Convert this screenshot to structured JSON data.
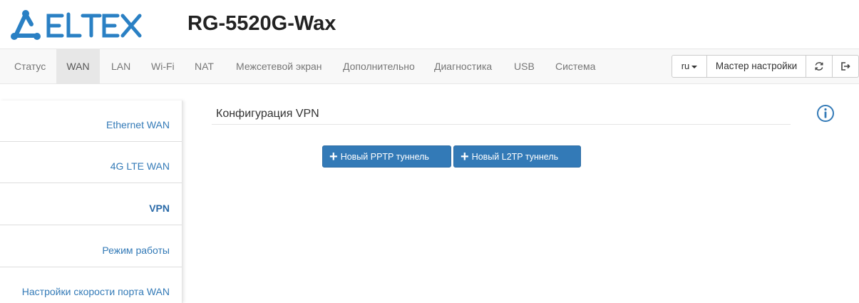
{
  "brand": {
    "logo_text": "ELTEX",
    "model": "RG-5520G-Wax",
    "logo_color": "#2a80c4"
  },
  "navbar": {
    "items": [
      {
        "label": "Статус"
      },
      {
        "label": "WAN",
        "active": true
      },
      {
        "label": "LAN"
      },
      {
        "label": "Wi-Fi"
      },
      {
        "label": "NAT"
      },
      {
        "label": "Межсетевой экран"
      },
      {
        "label": "Дополнительно"
      },
      {
        "label": "Диагностика"
      },
      {
        "label": "USB"
      },
      {
        "label": "Система"
      }
    ],
    "language": "ru",
    "wizard_label": "Мастер настройки",
    "refresh_icon": "refresh-icon",
    "logout_icon": "logout-icon"
  },
  "sidebar": {
    "items": [
      {
        "label": "Ethernet WAN"
      },
      {
        "label": "4G LTE WAN"
      },
      {
        "label": "VPN",
        "active": true
      },
      {
        "label": "Режим работы"
      },
      {
        "label": "Настройки скорости порта WAN"
      }
    ]
  },
  "main": {
    "title": "Конфигурация VPN",
    "info_icon": "info-icon",
    "buttons": {
      "new_pptp": "Новый PPTP туннель",
      "new_l2tp": "Новый L2TP туннель"
    }
  },
  "colors": {
    "primary": "#337ab7",
    "link": "#337ab7",
    "nav_bg": "#f8f8f8",
    "nav_active_bg": "#e7e7e7"
  }
}
